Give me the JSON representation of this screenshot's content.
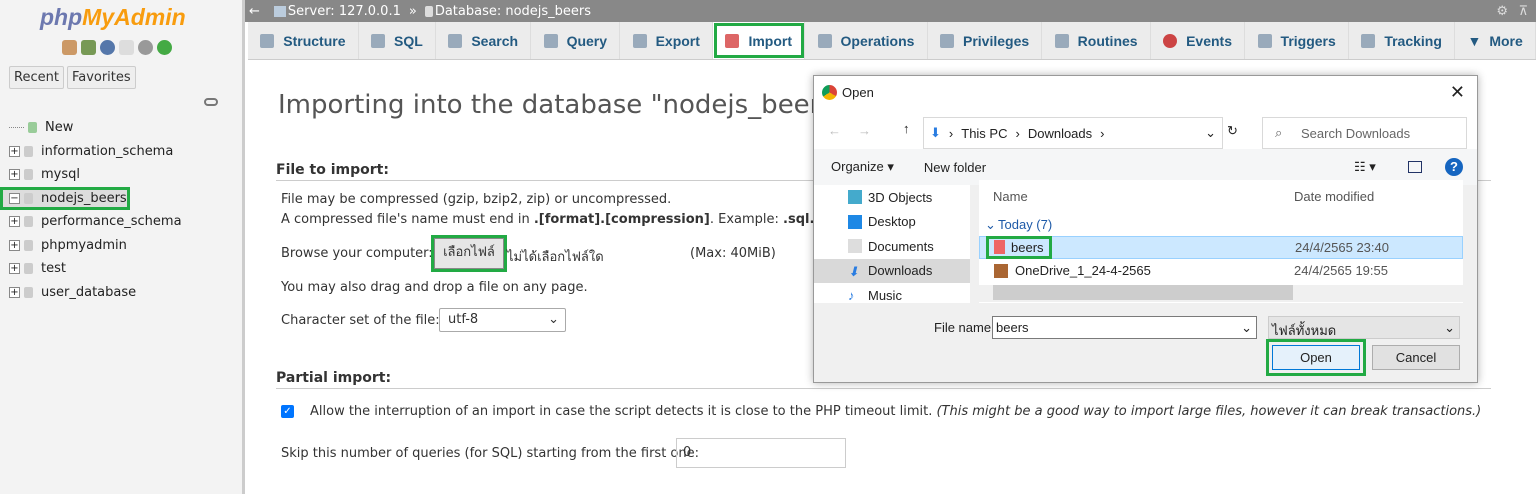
{
  "sidebar": {
    "logo_php": "php",
    "logo_myadmin": "MyAdmin",
    "recent": "Recent",
    "favorites": "Favorites",
    "items": [
      {
        "label": "New"
      },
      {
        "label": "information_schema"
      },
      {
        "label": "mysql"
      },
      {
        "label": "nodejs_beers"
      },
      {
        "label": "performance_schema"
      },
      {
        "label": "phpmyadmin"
      },
      {
        "label": "test"
      },
      {
        "label": "user_database"
      }
    ]
  },
  "breadcrumb": {
    "back": "←",
    "server": "Server: 127.0.0.1",
    "sep": "»",
    "database": "Database: nodejs_beers"
  },
  "tabs": [
    {
      "label": "Structure"
    },
    {
      "label": "SQL"
    },
    {
      "label": "Search"
    },
    {
      "label": "Query"
    },
    {
      "label": "Export"
    },
    {
      "label": "Import"
    },
    {
      "label": "Operations"
    },
    {
      "label": "Privileges"
    },
    {
      "label": "Routines"
    },
    {
      "label": "Events"
    },
    {
      "label": "Triggers"
    },
    {
      "label": "Tracking"
    },
    {
      "label": "More"
    }
  ],
  "main": {
    "title": "Importing into the database \"nodejs_beers\"",
    "file_section": "File to import:",
    "line1": "File may be compressed (gzip, bzip2, zip) or uncompressed.",
    "line2a": "A compressed file's name must end in ",
    "line2b": ".[format].[compression]",
    "line2c": ". Example: ",
    "line2d": ".sql.zip",
    "browse_label": "Browse your computer:",
    "choose_file": "เลือกไฟล์",
    "no_file": "ไม่ได้เลือกไฟล์ใด",
    "max": "(Max: 40MiB)",
    "drag": "You may also drag and drop a file on any page.",
    "charset_label": "Character set of the file:",
    "charset": "utf-8",
    "partial_section": "Partial import:",
    "allow_interrupt": "Allow the interruption of an import in case the script detects it is close to the PHP timeout limit.",
    "allow_note": "(This might be a good way to import large files, however it can break transactions.)",
    "allow_checked": true,
    "skip_label": "Skip this number of queries (for SQL) starting from the first one:",
    "skip_value": "0"
  },
  "dialog": {
    "title": "Open",
    "path": [
      "This PC",
      "Downloads"
    ],
    "search_placeholder": "Search Downloads",
    "organize": "Organize ▾",
    "new_folder": "New folder",
    "nav": [
      {
        "label": "3D Objects"
      },
      {
        "label": "Desktop"
      },
      {
        "label": "Documents"
      },
      {
        "label": "Downloads"
      },
      {
        "label": "Music"
      }
    ],
    "col_name": "Name",
    "col_date": "Date modified",
    "group": "Today (7)",
    "files": [
      {
        "name": "beers",
        "date": "24/4/2565 23:40"
      },
      {
        "name": "OneDrive_1_24-4-2565",
        "date": "24/4/2565 19:55"
      }
    ],
    "file_name_label": "File name:",
    "file_name": "beers",
    "file_type": "ไฟล์ทั้งหมด",
    "open": "Open",
    "cancel": "Cancel"
  },
  "colors": {
    "highlight": "#22aa44",
    "link": "#235a81"
  }
}
